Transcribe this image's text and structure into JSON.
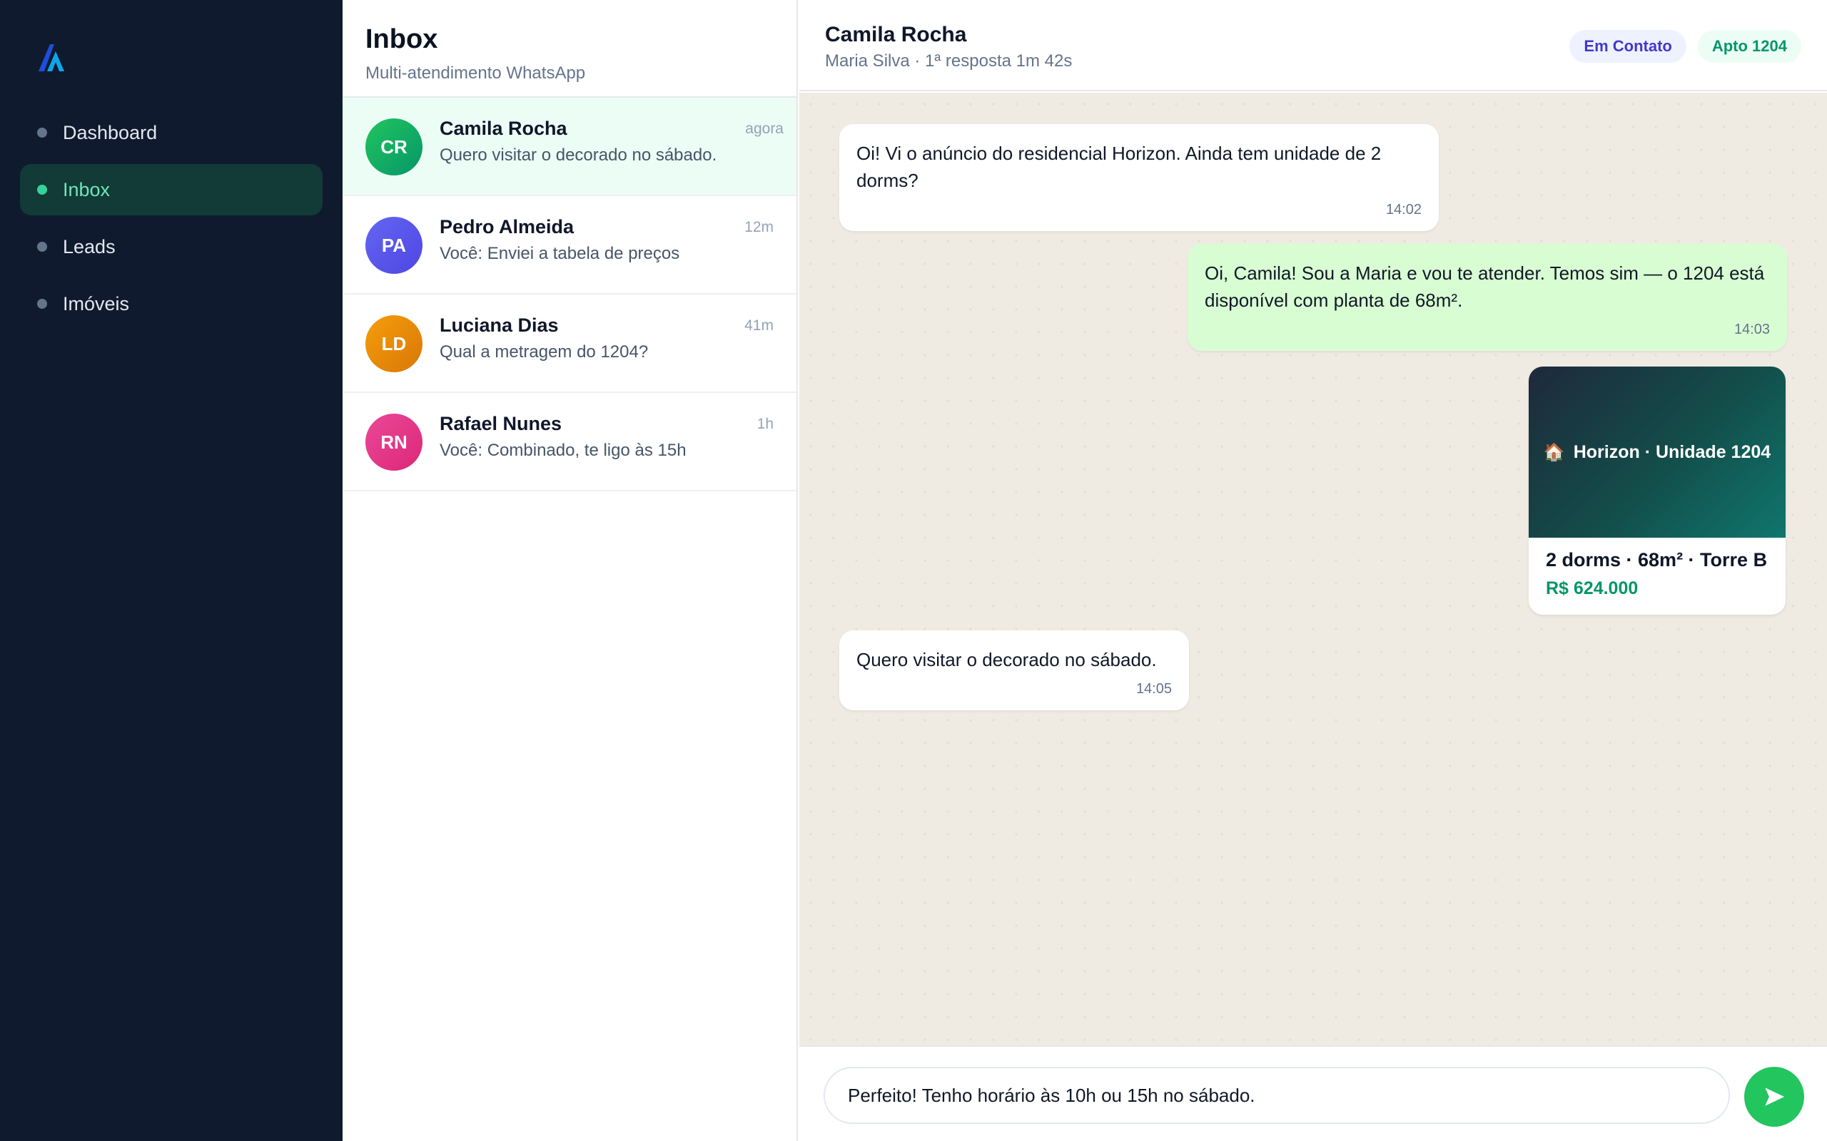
{
  "sidebar": {
    "logo_icon": "brand-logo-icon",
    "items": [
      {
        "label": "Dashboard",
        "active": false
      },
      {
        "label": "Inbox",
        "active": true
      },
      {
        "label": "Leads",
        "active": false
      },
      {
        "label": "Imóveis",
        "active": false
      }
    ]
  },
  "inbox": {
    "title": "Inbox",
    "subtitle": "Multi-atendimento WhatsApp",
    "conversations": [
      {
        "initials": "CR",
        "name": "Camila Rocha",
        "preview": "Quero visitar o decorado no sábado.",
        "time": "agora",
        "color": "#10b981",
        "active": true
      },
      {
        "initials": "PA",
        "name": "Pedro Almeida",
        "preview": "Você: Enviei a tabela de preços",
        "time": "12m",
        "color": "#6366f1",
        "active": false
      },
      {
        "initials": "LD",
        "name": "Luciana Dias",
        "preview": "Qual a metragem do 1204?",
        "time": "41m",
        "color": "#f59e0b",
        "active": false
      },
      {
        "initials": "RN",
        "name": "Rafael Nunes",
        "preview": "Você: Combinado, te ligo às 15h",
        "time": "1h",
        "color": "#ec4899",
        "active": false
      }
    ]
  },
  "chat": {
    "contact_name": "Camila Rocha",
    "meta": "Maria Silva · 1ª resposta 1m 42s",
    "badges": {
      "status": "Em Contato",
      "unit": "Apto 1204"
    },
    "messages": [
      {
        "direction": "in",
        "text": "Oi! Vi o anúncio do residencial Horizon. Ainda tem unidade de 2 dorms?",
        "time": "14:02"
      },
      {
        "direction": "out",
        "text": "Oi, Camila! Sou a Maria e vou te atender. Temos sim — o 1204 está disponível com planta de 68m².",
        "time": "14:03"
      },
      {
        "direction": "in",
        "text": "Quero visitar o decorado no sábado.",
        "time": "14:05"
      }
    ],
    "property_card": {
      "icon": "house-icon",
      "title": "Horizon · Unidade 1204",
      "specs": "2 dorms · 68m² · Torre B",
      "price": "R$ 624.000"
    },
    "composer": {
      "value": "Perfeito! Tenho horário às 10h ou 15h no sábado.",
      "send_icon": "send-icon"
    }
  },
  "colors": {
    "sidebar_bg": "#101a2e",
    "accent": "#22c55e",
    "outgoing_bubble": "#d9fdd3",
    "status_badge_text": "#4338ca",
    "price_text": "#059669"
  }
}
